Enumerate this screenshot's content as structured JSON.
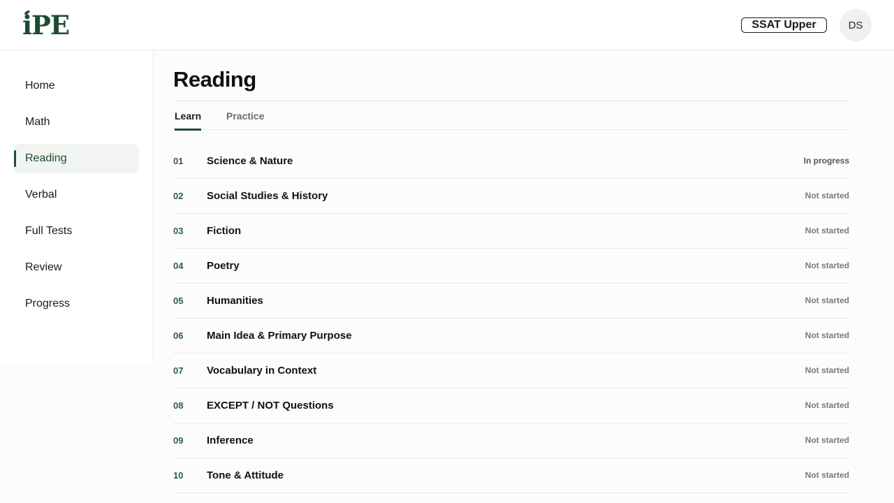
{
  "header": {
    "logo_text": "iPE",
    "exam_label": "SSAT Upper",
    "user_initials": "DS"
  },
  "sidebar": {
    "items": [
      {
        "label": "Home"
      },
      {
        "label": "Math"
      },
      {
        "label": "Reading",
        "active": true
      },
      {
        "label": "Verbal"
      },
      {
        "label": "Full Tests"
      },
      {
        "label": "Review"
      },
      {
        "label": "Progress"
      }
    ]
  },
  "main": {
    "title": "Reading",
    "tabs": [
      {
        "label": "Learn",
        "active": true
      },
      {
        "label": "Practice"
      }
    ],
    "topics": [
      {
        "num": "01",
        "name": "Science & Nature",
        "status": "In progress"
      },
      {
        "num": "02",
        "name": "Social Studies & History",
        "status": "Not started"
      },
      {
        "num": "03",
        "name": "Fiction",
        "status": "Not started"
      },
      {
        "num": "04",
        "name": "Poetry",
        "status": "Not started"
      },
      {
        "num": "05",
        "name": "Humanities",
        "status": "Not started"
      },
      {
        "num": "06",
        "name": "Main Idea & Primary Purpose",
        "status": "Not started"
      },
      {
        "num": "07",
        "name": "Vocabulary in Context",
        "status": "Not started"
      },
      {
        "num": "08",
        "name": "EXCEPT / NOT Questions",
        "status": "Not started"
      },
      {
        "num": "09",
        "name": "Inference",
        "status": "Not started"
      },
      {
        "num": "10",
        "name": "Tone & Attitude",
        "status": "Not started"
      }
    ]
  },
  "colors": {
    "brand": "#1f4a33",
    "accent_number": "#2f5d45",
    "status_text": "#7a7a7a",
    "active_nav_bg": "#f1f4f1"
  }
}
